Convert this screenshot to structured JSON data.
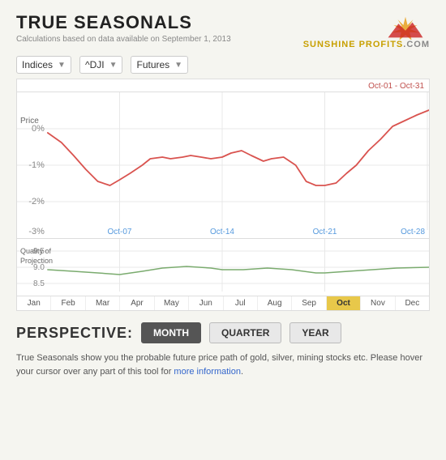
{
  "header": {
    "title": "TRUE SEASONALS",
    "subtitle": "Calculations based on data available on September 1, 2013",
    "logo_text": "SUNSHINE PROFITS",
    "logo_domain": ".COM"
  },
  "controls": {
    "dropdown1": "Indices",
    "dropdown2": "^DJI",
    "dropdown3": "Futures"
  },
  "chart": {
    "date_range": "Oct-01 - Oct-31",
    "price_label": "Price",
    "y_labels": [
      "0%",
      "-1%",
      "-2%",
      "-3%"
    ],
    "x_labels_weekly": [
      "Oct-07",
      "Oct-14",
      "Oct-21",
      "Oct-28"
    ],
    "quality_label": "Quality of\nProjection",
    "quality_y": [
      "9.5",
      "9.0",
      "8.5"
    ]
  },
  "months": [
    {
      "label": "Jan",
      "active": false
    },
    {
      "label": "Feb",
      "active": false
    },
    {
      "label": "Mar",
      "active": false
    },
    {
      "label": "Apr",
      "active": false
    },
    {
      "label": "May",
      "active": false
    },
    {
      "label": "Jun",
      "active": false
    },
    {
      "label": "Jul",
      "active": false
    },
    {
      "label": "Aug",
      "active": false
    },
    {
      "label": "Sep",
      "active": false
    },
    {
      "label": "Oct",
      "active": true
    },
    {
      "label": "Nov",
      "active": false
    },
    {
      "label": "Dec",
      "active": false
    }
  ],
  "perspective": {
    "label": "PERSPECTIVE:",
    "buttons": [
      {
        "label": "MONTH",
        "active": true
      },
      {
        "label": "QUARTER",
        "active": false
      },
      {
        "label": "YEAR",
        "active": false
      }
    ]
  },
  "description": {
    "text": "True Seasonals show you the probable future price path of gold, silver, mining stocks etc. Please hover your cursor over any part of this tool for ",
    "link_text": "more information",
    "text_after": "."
  }
}
